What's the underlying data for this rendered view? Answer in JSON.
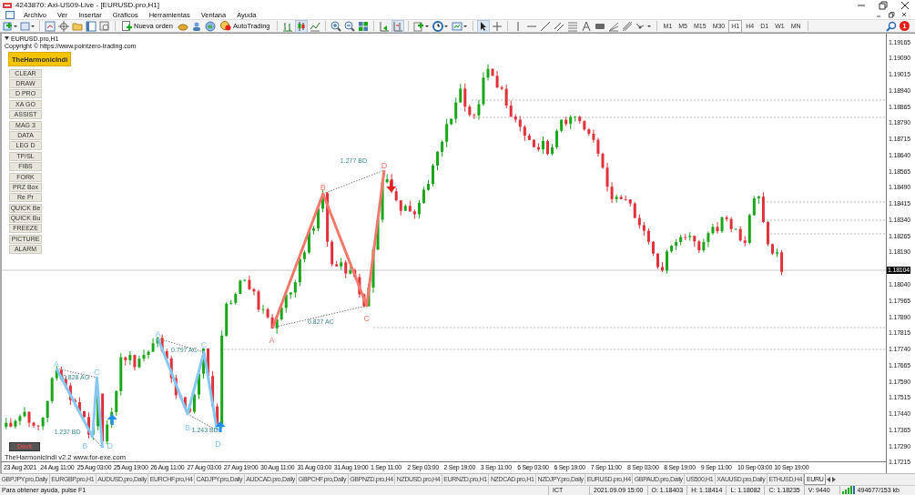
{
  "window": {
    "title": "4243870: Axi-US09-Live - [EURUSD.pro,H1]"
  },
  "menu": [
    "Archivo",
    "Ver",
    "Insertar",
    "Gráficos",
    "Herramientas",
    "Ventana",
    "Ayuda"
  ],
  "toolbar": {
    "new_order": "Nueva orden",
    "auto_trading": "AutoTrading",
    "notifications": "1",
    "timeframes": [
      {
        "label": "M1",
        "selected": false
      },
      {
        "label": "M5",
        "selected": false
      },
      {
        "label": "M15",
        "selected": false
      },
      {
        "label": "M30",
        "selected": false
      },
      {
        "label": "H1",
        "selected": true
      },
      {
        "label": "H4",
        "selected": false
      },
      {
        "label": "D1",
        "selected": false
      },
      {
        "label": "W1",
        "selected": false
      },
      {
        "label": "MN",
        "selected": false
      }
    ]
  },
  "chart": {
    "symbol": "EURUSD.pro,H1",
    "copyright": "Copyright © https://www.pointzero-trading.com",
    "indicator_button": "TheHarmonicIndi",
    "buttons": [
      "CLEAR",
      "DRAW",
      "D PRO",
      "XA GO",
      "ASSIST",
      "MAG 3",
      "DATA",
      "LEG D",
      "TP/SL",
      "FIBS",
      "FORK",
      "PRZ Box",
      "Re Pr",
      "QUICK Be",
      "QUICK Bu",
      "FREEZE",
      "PICTURE",
      "ALARM"
    ],
    "user_button": "Davit",
    "footer": "TheHarmonicIndi v2.2 www.for-exe.com",
    "price_axis": [
      "1.19165",
      "1.19090",
      "1.19015",
      "1.18940",
      "1.18865",
      "1.18790",
      "1.18715",
      "1.18640",
      "1.18565",
      "1.18490",
      "1.18415",
      "1.18340",
      "1.18265",
      "1.18190",
      "1.18040",
      "1.17965",
      "1.17890",
      "1.17815",
      "1.17740",
      "1.17665",
      "1.17590",
      "1.17515",
      "1.17440",
      "1.17365",
      "1.17290",
      "1.17215"
    ],
    "current_price": "1.18104",
    "time_axis": [
      "23 Aug 2021",
      "24 Aug 11:00",
      "25 Aug 03:00",
      "25 Aug 19:00",
      "26 Aug 11:00",
      "27 Aug 03:00",
      "27 Aug 19:00",
      "30 Aug 11:00",
      "31 Aug 03:00",
      "31 Aug 19:00",
      "1 Sep 11:00",
      "2 Sep 03:00",
      "2 Sep 19:00",
      "3 Sep 11:00",
      "6 Sep 03:00",
      "6 Sep 19:00",
      "7 Sep 11:00",
      "8 Sep 03:00",
      "8 Sep 19:00",
      "9 Sep 11:00",
      "10 Sep 03:00",
      "10 Sep 19:00"
    ],
    "patterns": [
      {
        "color": "#f2796c",
        "bullish": false,
        "points": [
          "A",
          "B",
          "C",
          "D"
        ],
        "ratios": [
          "0.827 AC",
          "1.277 BD"
        ]
      },
      {
        "color": "#86c8f2",
        "bullish": true,
        "points": [
          "A",
          "B",
          "C",
          "D"
        ],
        "ratios": [
          "0.828 AG",
          "1.237 BD"
        ]
      },
      {
        "color": "#86c8f2",
        "bullish": true,
        "points": [
          "A",
          "B",
          "C",
          "D"
        ],
        "ratios": [
          "0.797 AC",
          "1.243 BD"
        ]
      }
    ]
  },
  "tabs": [
    {
      "label": "GBPJPY.pro,Daily",
      "selected": false
    },
    {
      "label": "EURGBP.pro,H1",
      "selected": false
    },
    {
      "label": "AUDUSD.pro,Daily",
      "selected": false
    },
    {
      "label": "EURCHF.pro,H4",
      "selected": false
    },
    {
      "label": "CADJPY.pro,Daily",
      "selected": false
    },
    {
      "label": "AUDCAD.pro,Daily",
      "selected": false
    },
    {
      "label": "GBPCHF.pro,Daily",
      "selected": false
    },
    {
      "label": "GBPNZD.pro,H4",
      "selected": false
    },
    {
      "label": "NZDUSD.pro,H4",
      "selected": false
    },
    {
      "label": "EURNZD.pro,H1",
      "selected": false
    },
    {
      "label": "NZDCAD.pro,H1",
      "selected": false
    },
    {
      "label": "NZDJPY.pro,Daily",
      "selected": false
    },
    {
      "label": "EURUSD.pro,H4",
      "selected": false
    },
    {
      "label": "GBPAUD.pro,Daily",
      "selected": false
    },
    {
      "label": "US500,H1",
      "selected": false
    },
    {
      "label": "XAUUSD.pro,Daily",
      "selected": false
    },
    {
      "label": "ETHUSD,H4",
      "selected": false
    },
    {
      "label": "EURU",
      "selected": true
    }
  ],
  "status_bar": {
    "help": "Para obtener ayuda, pulse F1",
    "timezone": "ICT",
    "time": "2021.09.09 15:00",
    "open": "O: 1.18403",
    "high": "H: 1.18414",
    "low": "L: 1.18082",
    "close": "C: 1.18235",
    "volume": "V: 9440",
    "traffic": "494677/153 kb"
  }
}
